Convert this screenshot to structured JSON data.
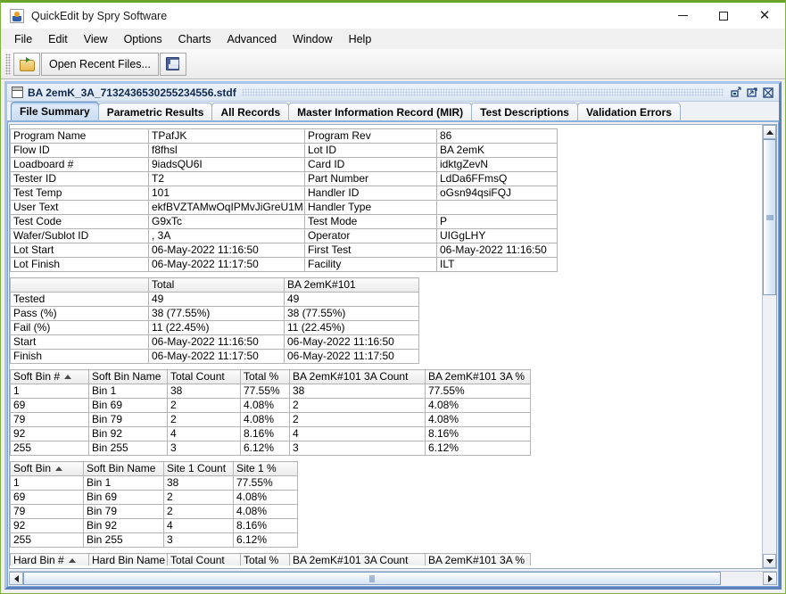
{
  "window": {
    "title": "QuickEdit by Spry Software",
    "app_icon": "java-coffee-cup-icon",
    "controls": {
      "minimize": "minimize-icon",
      "maximize": "maximize-icon",
      "close": "close-icon"
    }
  },
  "menubar": {
    "items": [
      "File",
      "Edit",
      "View",
      "Options",
      "Charts",
      "Advanced",
      "Window",
      "Help"
    ]
  },
  "toolbar": {
    "open_icon": "folder-open-icon",
    "open_recent_label": "Open Recent Files...",
    "save_icon": "save-floppy-icon"
  },
  "internal_frame": {
    "title": "BA 2emK_3A_7132436530255234556.stdf",
    "doc_icon": "document-icon",
    "iconify": "iconify-icon",
    "maximize": "restore-icon",
    "close": "close-frame-icon"
  },
  "tabs": [
    {
      "label": "File Summary",
      "active": true
    },
    {
      "label": "Parametric Results",
      "active": false
    },
    {
      "label": "All Records",
      "active": false
    },
    {
      "label": "Master Information Record (MIR)",
      "active": false
    },
    {
      "label": "Test Descriptions",
      "active": false
    },
    {
      "label": "Validation Errors",
      "active": false
    }
  ],
  "info_table": {
    "rows": [
      {
        "l1": "Program Name",
        "v1": "TPafJK",
        "l2": "Program Rev",
        "v2": "86"
      },
      {
        "l1": "Flow ID",
        "v1": "f8fhsl",
        "l2": "Lot ID",
        "v2": "BA 2emK"
      },
      {
        "l1": "Loadboard #",
        "v1": "9iadsQU6I",
        "l2": "Card ID",
        "v2": "idktgZevN"
      },
      {
        "l1": "Tester ID",
        "v1": "T2",
        "l2": "Part Number",
        "v2": "LdDa6FFmsQ"
      },
      {
        "l1": "Test Temp",
        "v1": "101",
        "l2": "Handler ID",
        "v2": "oGsn94qsiFQJ"
      },
      {
        "l1": "User Text",
        "v1": "ekfBVZTAMwOqIPMvJiGreU1M",
        "l2": "Handler Type",
        "v2": ""
      },
      {
        "l1": "Test Code",
        "v1": "G9xTc",
        "l2": "Test Mode",
        "v2": "P"
      },
      {
        "l1": "Wafer/Sublot ID",
        "v1": ", 3A",
        "l2": "Operator",
        "v2": "UIGgLHY"
      },
      {
        "l1": "Lot Start",
        "v1": "06-May-2022 11:16:50",
        "l2": "First Test",
        "v2": "06-May-2022 11:16:50"
      },
      {
        "l1": "Lot Finish",
        "v1": "06-May-2022 11:17:50",
        "l2": "Facility",
        "v2": "ILT"
      }
    ]
  },
  "summary_table": {
    "headers": [
      "",
      "Total",
      "BA 2emK#101"
    ],
    "rows": [
      {
        "label": "Tested",
        "total": "49",
        "site": "49"
      },
      {
        "label": "Pass (%)",
        "total": "38 (77.55%)",
        "site": "38 (77.55%)"
      },
      {
        "label": "Fail (%)",
        "total": "11 (22.45%)",
        "site": "11 (22.45%)"
      },
      {
        "label": "Start",
        "total": "06-May-2022 11:16:50",
        "site": "06-May-2022 11:16:50"
      },
      {
        "label": "Finish",
        "total": "06-May-2022 11:17:50",
        "site": "06-May-2022 11:17:50"
      }
    ]
  },
  "softbin_total_table": {
    "headers": [
      "Soft Bin #",
      "Soft Bin Name",
      "Total Count",
      "Total %",
      "BA 2emK#101 3A Count",
      "BA 2emK#101 3A %"
    ],
    "sorted_column": 0,
    "sort_direction": "ascending",
    "rows": [
      {
        "bin": "1",
        "name": "Bin 1",
        "count": "38",
        "pct": "77.55%",
        "site_count": "38",
        "site_pct": "77.55%"
      },
      {
        "bin": "69",
        "name": "Bin 69",
        "count": "2",
        "pct": "4.08%",
        "site_count": "2",
        "site_pct": "4.08%"
      },
      {
        "bin": "79",
        "name": "Bin 79",
        "count": "2",
        "pct": "4.08%",
        "site_count": "2",
        "site_pct": "4.08%"
      },
      {
        "bin": "92",
        "name": "Bin 92",
        "count": "4",
        "pct": "8.16%",
        "site_count": "4",
        "site_pct": "8.16%"
      },
      {
        "bin": "255",
        "name": "Bin 255",
        "count": "3",
        "pct": "6.12%",
        "site_count": "3",
        "site_pct": "6.12%"
      }
    ]
  },
  "softbin_site_table": {
    "headers": [
      "Soft Bin",
      "Soft Bin Name",
      "Site 1 Count",
      "Site 1 %"
    ],
    "sorted_column": 0,
    "sort_direction": "ascending",
    "rows": [
      {
        "bin": "1",
        "name": "Bin 1",
        "count": "38",
        "pct": "77.55%"
      },
      {
        "bin": "69",
        "name": "Bin 69",
        "count": "2",
        "pct": "4.08%"
      },
      {
        "bin": "79",
        "name": "Bin 79",
        "count": "2",
        "pct": "4.08%"
      },
      {
        "bin": "92",
        "name": "Bin 92",
        "count": "4",
        "pct": "8.16%"
      },
      {
        "bin": "255",
        "name": "Bin 255",
        "count": "3",
        "pct": "6.12%"
      }
    ]
  },
  "hardbin_table": {
    "headers": [
      "Hard Bin #",
      "Hard Bin Name",
      "Total Count",
      "Total %",
      "BA 2emK#101 3A Count",
      "BA 2emK#101 3A %"
    ],
    "sorted_column": 0,
    "sort_direction": "ascending"
  },
  "scrollbars": {
    "vertical": {
      "up": "scroll-up-arrow-icon",
      "down": "scroll-down-arrow-icon"
    },
    "horizontal": {
      "left": "scroll-left-arrow-icon",
      "right": "scroll-right-arrow-icon"
    }
  },
  "colors": {
    "accent": "#5b82bd",
    "tab_active": "#c9ddf4",
    "window_border": "#7fb43c"
  }
}
